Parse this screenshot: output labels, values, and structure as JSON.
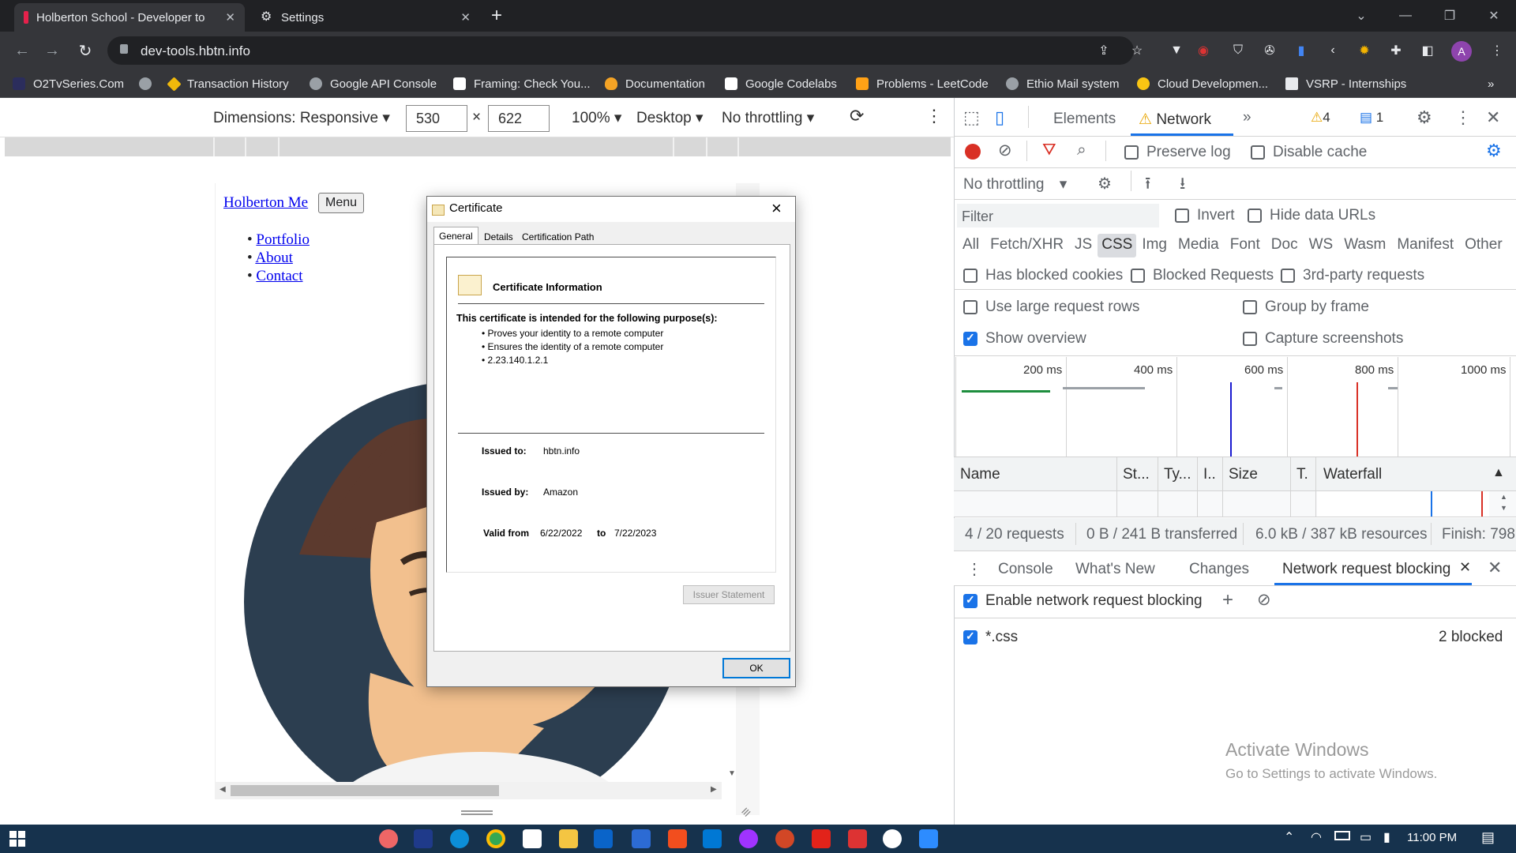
{
  "tabs": [
    {
      "title": "Holberton School - Developer to",
      "active": true
    },
    {
      "title": "Settings",
      "active": false
    }
  ],
  "new_tab": "+",
  "address": {
    "url": "dev-tools.hbtn.info"
  },
  "bookmarks": [
    "O2TvSeries.Com",
    "Transaction History",
    "Google API Console",
    "Framing: Check You...",
    "Documentation",
    "Google Codelabs",
    "Problems - LeetCode",
    "Ethio Mail system",
    "Cloud Developmen...",
    "VSRP - Internships"
  ],
  "bookmarks_more": "»",
  "avatar_letter": "A",
  "device_toolbar": {
    "dimensions_label": "Dimensions: Responsive",
    "width": "530",
    "times": "×",
    "height": "622",
    "zoom": "100%",
    "device": "Desktop",
    "throttle": "No throttling"
  },
  "page": {
    "nav_link": "Holberton Me",
    "menu_button": "Menu",
    "links": [
      "Portfolio",
      "About",
      "Contact"
    ]
  },
  "certificate": {
    "title": "Certificate",
    "close": "×",
    "tabs": [
      "General",
      "Details",
      "Certification Path"
    ],
    "heading": "Certificate Information",
    "purpose_intro": "This certificate is intended for the following purpose(s):",
    "purposes": [
      "Proves your identity to a remote computer",
      "Ensures the identity of a remote computer",
      "2.23.140.1.2.1"
    ],
    "issued_to_label": "Issued to:",
    "issued_to": "hbtn.info",
    "issued_by_label": "Issued by:",
    "issued_by": "Amazon",
    "valid_from_label": "Valid from",
    "valid_from": "6/22/2022",
    "to_label": "to",
    "valid_to": "7/22/2023",
    "issuer_statement": "Issuer Statement",
    "ok": "OK"
  },
  "devtools": {
    "tabs": {
      "elements": "Elements",
      "network": "Network",
      "more": "»"
    },
    "warnings": "4",
    "messages": "1",
    "preserve_log": "Preserve log",
    "disable_cache": "Disable cache",
    "throttling": "No throttling",
    "filter_placeholder": "Filter",
    "invert": "Invert",
    "hide_data_urls": "Hide data URLs",
    "type_filters": [
      "All",
      "Fetch/XHR",
      "JS",
      "CSS",
      "Img",
      "Media",
      "Font",
      "Doc",
      "WS",
      "Wasm",
      "Manifest",
      "Other"
    ],
    "selected_type": "CSS",
    "has_blocked_cookies": "Has blocked cookies",
    "blocked_requests": "Blocked Requests",
    "third_party": "3rd-party requests",
    "large_rows": "Use large request rows",
    "group_by_frame": "Group by frame",
    "show_overview": "Show overview",
    "capture_screenshots": "Capture screenshots",
    "timeline_ticks": [
      "200 ms",
      "400 ms",
      "600 ms",
      "800 ms",
      "1000 ms"
    ],
    "columns": [
      "Name",
      "St...",
      "Ty...",
      "I..",
      "Size",
      "T.",
      "Waterfall"
    ],
    "sort_indicator": "▲",
    "summary": {
      "requests": "4 / 20 requests",
      "transferred": "0 B / 241 B transferred",
      "resources": "6.0 kB / 387 kB resources",
      "finish": "Finish: 798"
    },
    "drawer_tabs": [
      "Console",
      "What's New",
      "Changes",
      "Network request blocking"
    ],
    "enable_blocking": "Enable network request blocking",
    "pattern": "*.css",
    "blocked_count": "2 blocked"
  },
  "watermark": {
    "title": "Activate Windows",
    "subtitle": "Go to Settings to activate Windows."
  },
  "taskbar": {
    "time": "11:00 PM"
  },
  "colors": {
    "chrome_dark": "#202124",
    "chrome_toolbar": "#35363a",
    "accent": "#1a73e8",
    "taskbar": "#16324d"
  }
}
